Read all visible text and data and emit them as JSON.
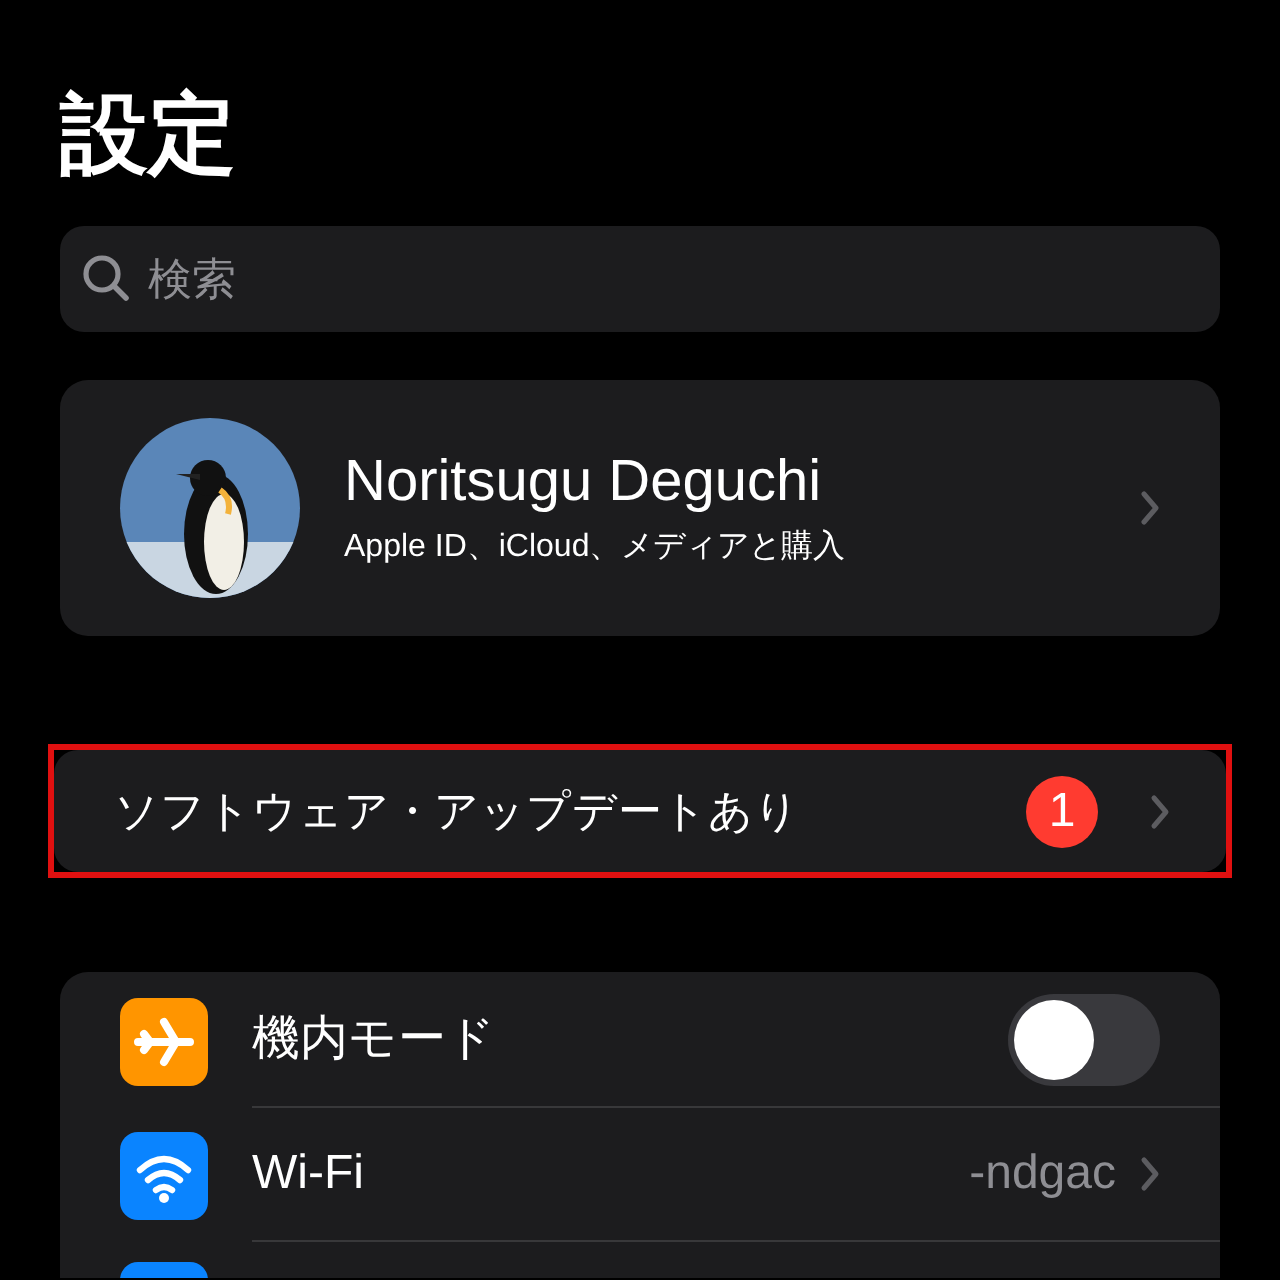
{
  "title": "設定",
  "search": {
    "placeholder": "検索"
  },
  "profile": {
    "name": "Noritsugu Deguchi",
    "subtitle": "Apple ID、iCloud、メディアと購入"
  },
  "update": {
    "label": "ソフトウェア・アップデートあり",
    "badge": "1",
    "highlighted": true
  },
  "settings": [
    {
      "kind": "toggle",
      "label": "機内モード",
      "on": false
    },
    {
      "kind": "link",
      "label": "Wi-Fi",
      "value": "-ndgac"
    },
    {
      "kind": "partial"
    }
  ]
}
